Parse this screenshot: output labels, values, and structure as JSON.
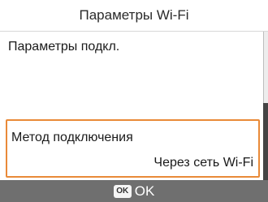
{
  "header": {
    "title": "Параметры Wi-Fi"
  },
  "menu": {
    "items": [
      {
        "label": "Параметры подкл."
      },
      {
        "label": "Метод подключения",
        "value": "Через сеть Wi-Fi",
        "selected": true
      }
    ]
  },
  "footer": {
    "key_badge": "OK",
    "action_label": "OK"
  },
  "colors": {
    "selection_border": "#e98a38",
    "footer_background": "#6f6f6f"
  }
}
